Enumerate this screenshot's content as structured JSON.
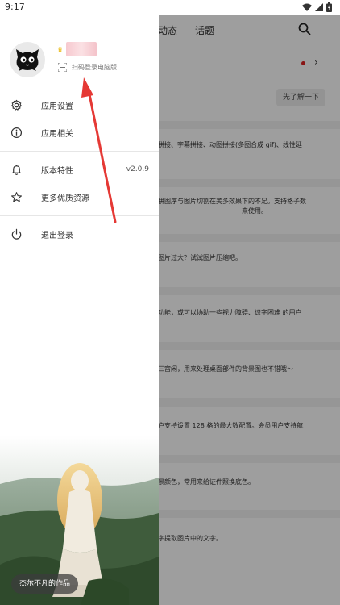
{
  "status_bar": {
    "time": "9:17"
  },
  "background_app": {
    "tabs": [
      "动态",
      "话题"
    ],
    "button_label": "先了解一下",
    "snippets": [
      "拼接、字幕拼接、动图拼接(多图合成 gif)、线性延",
      "拼图序与图片切割在美多效果下的不足。支持格子数",
      "来使用。",
      "图片过大？试试图片压缩吧。",
      "功能，或可以协助一些视力障碍、识字困难 的用户",
      "三宫闲，用来处理桌面部件的背景图也不错哦～",
      "户支持设置 128 格的最大数配置。会员用户支持航",
      "景颜色，常用来给证件照换底色。",
      "字提取图片中的文字。"
    ]
  },
  "drawer": {
    "scan_label": "扫码登录电脑版",
    "menu": [
      {
        "label": "应用设置",
        "icon": "gear-icon"
      },
      {
        "label": "应用相关",
        "icon": "info-icon"
      },
      {
        "label": "版本特性",
        "icon": "bell-icon",
        "value": "v2.0.9"
      },
      {
        "label": "更多优质资源",
        "icon": "star-icon"
      },
      {
        "label": "退出登录",
        "icon": "power-icon"
      }
    ],
    "credit": "杰尔不凡的作品"
  },
  "colors": {
    "annotation_arrow": "#e53935",
    "crown": "#e8b400"
  }
}
